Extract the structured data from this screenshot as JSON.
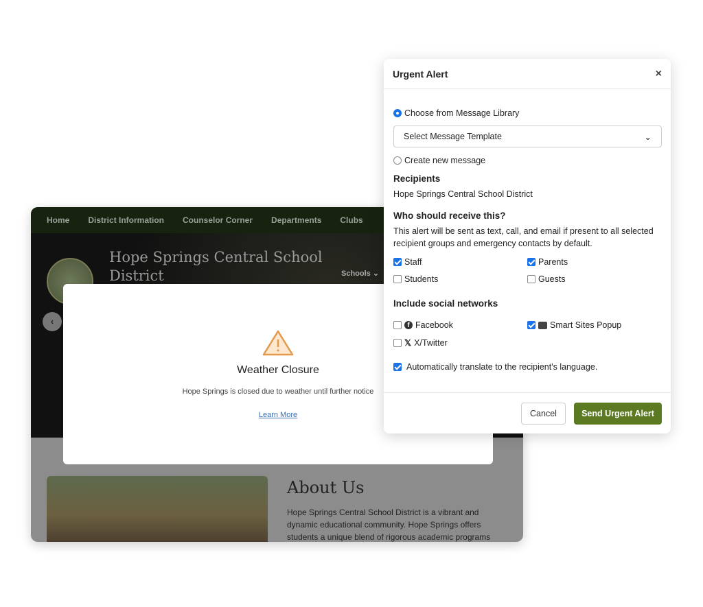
{
  "site": {
    "nav": [
      "Home",
      "District Information",
      "Counselor Corner",
      "Departments",
      "Clubs"
    ],
    "title": "Hope Springs Central School District",
    "schools_menu": "Schools",
    "about_title": "About Us",
    "about_text": "Hope Springs Central School District is a vibrant and dynamic educational community. Hope Springs offers students a unique blend of rigorous academic programs"
  },
  "popup": {
    "title": "Weather Closure",
    "text": "Hope Springs is closed due to weather until further notice",
    "link": "Learn More",
    "icon": "warning-triangle-icon"
  },
  "dialog": {
    "title": "Urgent Alert",
    "close": "×",
    "option_library": "Choose from Message Library",
    "select_value": "Select Message Template",
    "option_new": "Create new message",
    "recipients_heading": "Recipients",
    "recipients_value": "Hope Springs Central School District",
    "who_heading": "Who should receive this?",
    "who_text": "This alert will be sent as text, call, and email if present to all selected recipient groups and emergency contacts by default.",
    "groups": [
      {
        "label": "Staff",
        "checked": true
      },
      {
        "label": "Parents",
        "checked": true
      },
      {
        "label": "Students",
        "checked": false
      },
      {
        "label": "Guests",
        "checked": false
      }
    ],
    "social_heading": "Include social networks",
    "social": [
      {
        "label": "Facebook",
        "checked": false,
        "icon": "facebook-icon"
      },
      {
        "label": "Smart Sites Popup",
        "checked": true,
        "icon": "newspaper-icon"
      },
      {
        "label": "X/Twitter",
        "checked": false,
        "icon": "x-twitter-icon"
      }
    ],
    "translate": {
      "label": "Automatically translate to the recipient's language.",
      "checked": true
    },
    "cancel": "Cancel",
    "send": "Send Urgent Alert"
  },
  "colors": {
    "accent": "#1a73e8",
    "send_button": "#5b7a22",
    "nav": "#17230f"
  }
}
